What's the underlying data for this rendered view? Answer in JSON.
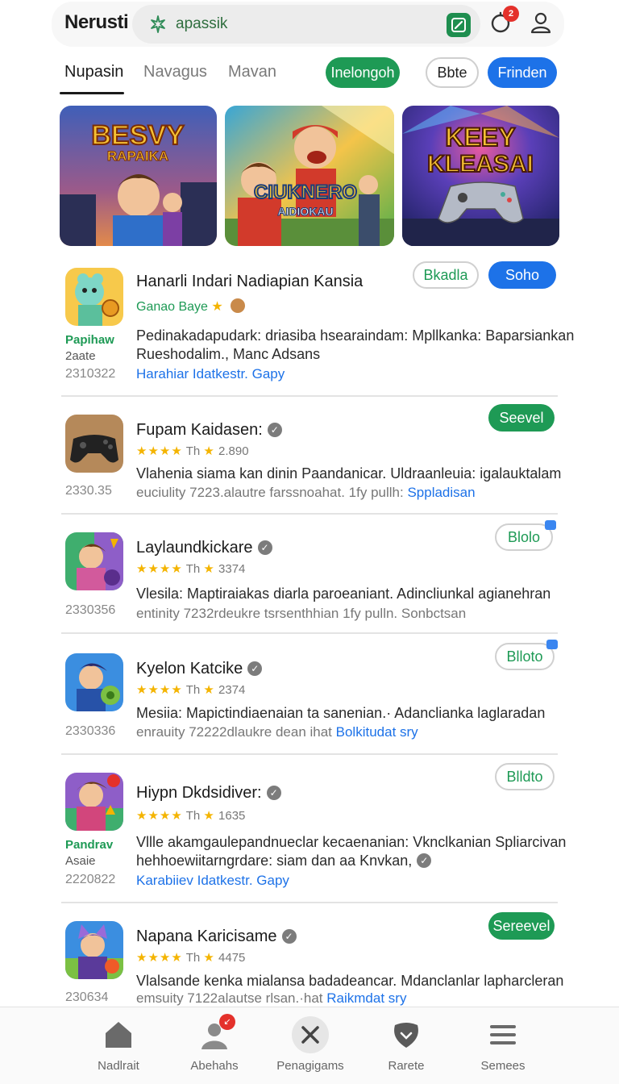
{
  "header": {
    "app_title": "Nerusti",
    "search_value": "apassik",
    "notification_count": "2"
  },
  "tabs": [
    {
      "label": "Nupasin",
      "active": true
    },
    {
      "label": "Navagus",
      "active": false
    },
    {
      "label": "Mavan",
      "active": false
    }
  ],
  "chips": {
    "green": "Inelongoh",
    "outline": "Bbte",
    "blue": "Frinden"
  },
  "banners": [
    {
      "title_line1": "BESVY",
      "title_line2": "RAPAIKA"
    },
    {
      "title_line1": "CIUKNERO",
      "title_line2": "AIDIOKAU"
    },
    {
      "title_line1": "KEEY",
      "title_line2": "KLEASAI"
    }
  ],
  "items": [
    {
      "name": "Hanarli Indari Nadiapian Kansia",
      "verified": false,
      "subtitle": "Ganao Baye",
      "side_label": "Papihaw",
      "side_sub": "2aate",
      "side_num": "2310322",
      "desc_line1": "Pedinakadapudark: driasiba hsearaindam: Mpllkanka: Baparsiankan",
      "desc_line2": "Rueshodalim., Manc Adsans",
      "link": "Harahiar Idatkestr. Gapy",
      "action_outline": "Bkadla",
      "action_primary": "Soho"
    },
    {
      "name": "Fupam Kaidasen:",
      "verified": true,
      "rating_text": "Th",
      "rating_count": "2.890",
      "side_num": "2330.35",
      "desc_line1": "Vlahenia siama kan dinin Paandanicar. Uldraanleuia: igalauktalam",
      "desc_line2": "euciulity 7223.alautre farssnoahat. 1fy pullh:",
      "link": "Sppladisan",
      "action": "Seevel"
    },
    {
      "name": "Laylaundkickare",
      "verified": true,
      "rating_text": "Th",
      "rating_count": "3374",
      "side_num": "2330356",
      "desc_line1": "Vlesila: Maptiraiakas diarla paroeaniant. Adincliunkal agianehran",
      "desc_line2": "entinity 7232rdeukre tsrsenthhian 1fy pulln. Sonbctsan",
      "action": "Blolo"
    },
    {
      "name": "Kyelon Katcike",
      "verified": true,
      "rating_text": "Th",
      "rating_count": "2374",
      "side_num": "2330336",
      "desc_line1": "Mesiia: Mapictindiaenaian ta sanenian.· Adanclianka laglaradan",
      "desc_line2": "enrauity 72222dlaukre dean ihat",
      "link": "Bolkitudat sry",
      "action": "Blloto"
    },
    {
      "name": "Hiypn Dkdsidiver:",
      "verified": true,
      "rating_text": "Th",
      "rating_count": "1635",
      "side_label": "Pandrav",
      "side_sub": "Asaie",
      "side_num": "2220822",
      "desc_line1": "Vllle akamgaulepandnueclar kecaenanian: Vknclkanian Spliarcivan",
      "desc_line2": "hehhoewiitarngrdare: siam dan aa Knvkan,",
      "link": "Karabiiev Idatkestr. Gapy",
      "action": "Blldto"
    },
    {
      "name": "Napana Karicisame",
      "verified": true,
      "rating_text": "Th",
      "rating_count": "4475",
      "side_num": "230634",
      "desc_line1": "Vlalsande kenka mialansa badadeancar. Mdanclanlar lapharcleran",
      "desc_line2": "emsuity 7122alautse rlsan.·hat",
      "link": "Raikmdat sry",
      "action": "Sereevel"
    }
  ],
  "bottom_nav": [
    {
      "label": "Nadlrait",
      "icon": "home-icon"
    },
    {
      "label": "Abehahs",
      "icon": "person-icon",
      "badge": "↙"
    },
    {
      "label": "Penagigams",
      "icon": "close-icon"
    },
    {
      "label": "Rarete",
      "icon": "shield-heart-icon"
    },
    {
      "label": "Semees",
      "icon": "menu-icon"
    }
  ],
  "colors": {
    "accent_green": "#1e9a55",
    "accent_blue": "#1d72e8",
    "badge_red": "#e4312b",
    "star_yellow": "#f4b400"
  }
}
